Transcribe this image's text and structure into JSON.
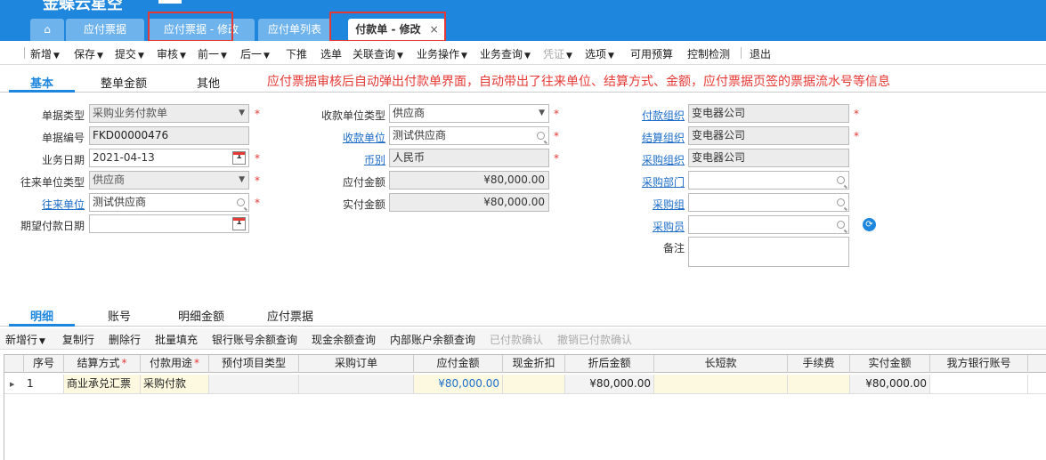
{
  "app": {
    "logo_text": "金蝶云星空"
  },
  "tabs": [
    {
      "label": "应付票据"
    },
    {
      "label": "应付票据 - 修改"
    },
    {
      "label": "应付单列表"
    },
    {
      "label": "付款单 - 修改",
      "close": "×"
    }
  ],
  "toolbar": {
    "items": [
      "新增",
      "保存",
      "提交",
      "审核",
      "前一",
      "后一",
      "下推",
      "选单",
      "关联查询",
      "业务操作",
      "业务查询",
      "凭证",
      "选项",
      "可用预算",
      "控制检测",
      "退出"
    ]
  },
  "form_tabs": [
    "基本",
    "整单金额",
    "其他"
  ],
  "annotation": "应付票据审核后自动弹出付款单界面，自动带出了往来单位、结算方式、金额，应付票据页签的票据流水号等信息",
  "form": {
    "bill_type": {
      "label": "单据类型",
      "value": "采购业务付款单"
    },
    "bill_no": {
      "label": "单据编号",
      "value": "FKD00000476"
    },
    "biz_date": {
      "label": "业务日期",
      "value": "2021-04-13"
    },
    "contact_type": {
      "label": "往来单位类型",
      "value": "供应商"
    },
    "contact_unit": {
      "label": "往来单位",
      "value": "测试供应商"
    },
    "expect_date": {
      "label": "期望付款日期",
      "value": ""
    },
    "payee_type": {
      "label": "收款单位类型",
      "value": "供应商"
    },
    "payee": {
      "label": "收款单位",
      "value": "测试供应商"
    },
    "currency": {
      "label": "币别",
      "value": "人民币"
    },
    "payable_amount": {
      "label": "应付金额",
      "value": "¥80,000.00"
    },
    "paid_amount": {
      "label": "实付金额",
      "value": "¥80,000.00"
    },
    "pay_org": {
      "label": "付款组织",
      "value": "变电器公司"
    },
    "settle_org": {
      "label": "结算组织",
      "value": "变电器公司"
    },
    "purchase_org": {
      "label": "采购组织",
      "value": "变电器公司"
    },
    "purchase_dept": {
      "label": "采购部门",
      "value": ""
    },
    "purchase_group": {
      "label": "采购组",
      "value": ""
    },
    "purchaser": {
      "label": "采购员",
      "value": ""
    },
    "remark": {
      "label": "备注",
      "value": ""
    },
    "calendar_day": "1",
    "required_mark": "*"
  },
  "detail_tabs": [
    "明细",
    "账号",
    "明细金额",
    "应付票据"
  ],
  "detail_toolbar": [
    "新增行",
    "复制行",
    "删除行",
    "批量填充",
    "银行账号余额查询",
    "现金余额查询",
    "内部账户余额查询",
    "已付款确认",
    "撤销已付款确认"
  ],
  "grid": {
    "columns": [
      "序号",
      "结算方式",
      "付款用途",
      "预付项目类型",
      "采购订单",
      "应付金额",
      "现金折扣",
      "折后金额",
      "长短款",
      "手续费",
      "实付金额",
      "我方银行账号"
    ],
    "rows": [
      [
        "1",
        "商业承兑汇票",
        "采购付款",
        "",
        "",
        "¥80,000.00",
        "",
        "¥80,000.00",
        "",
        "",
        "¥80,000.00",
        ""
      ]
    ]
  }
}
